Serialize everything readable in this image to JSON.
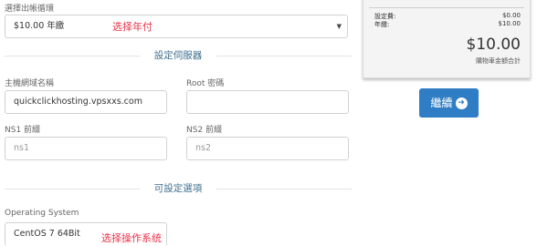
{
  "billing": {
    "label": "選擇出帳循環",
    "selected": "$10.00 年繳",
    "annotation": "选择年付"
  },
  "server_section": {
    "title": "設定伺服器"
  },
  "hostname": {
    "label": "主機網域名稱",
    "value": "quickclickhosting.vpsxxs.com"
  },
  "root_password": {
    "label": "Root 密碼",
    "value": ""
  },
  "ns1": {
    "label": "NS1 前綴",
    "placeholder": "ns1"
  },
  "ns2": {
    "label": "NS2 前綴",
    "placeholder": "ns2"
  },
  "options_section": {
    "title": "可設定選項"
  },
  "os": {
    "label": "Operating System",
    "selected": "CentOS 7 64Bit",
    "annotation": "选择操作系统"
  },
  "summary": {
    "setup_label": "設定費:",
    "setup_value": "$0.00",
    "annual_label": "年繳:",
    "annual_value": "$10.00",
    "total": "$10.00",
    "total_note": "購物車金額合計"
  },
  "continue_button": {
    "label": "繼續",
    "icon": "arrow-circle-right-icon"
  }
}
